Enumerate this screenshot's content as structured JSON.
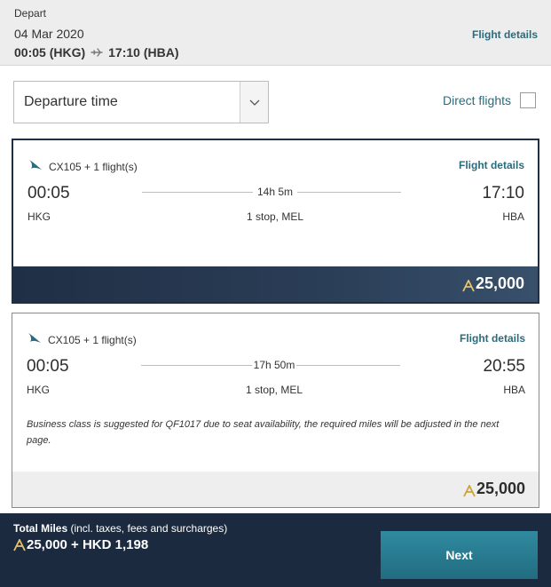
{
  "header": {
    "label": "Depart",
    "date": "04 Mar 2020",
    "departure": "00:05 (HKG)",
    "arrival": "17:10 (HBA)",
    "flight_details": "Flight details"
  },
  "filters": {
    "sort_value": "Departure time",
    "direct_label": "Direct flights",
    "direct_checked": false
  },
  "options": [
    {
      "flight": "CX105 + 1 flight(s)",
      "flight_details": "Flight details",
      "dep_time": "00:05",
      "arr_time": "17:10",
      "duration": "14h 5m",
      "dep_airport": "HKG",
      "arr_airport": "HBA",
      "stops": "1 stop, MEL",
      "note": "",
      "price": "25,000",
      "selected": true
    },
    {
      "flight": "CX105 + 1 flight(s)",
      "flight_details": "Flight details",
      "dep_time": "00:05",
      "arr_time": "20:55",
      "duration": "17h 50m",
      "dep_airport": "HKG",
      "arr_airport": "HBA",
      "stops": "1 stop, MEL",
      "note": "Business class is suggested for QF1017 due to seat availability, the required miles will be adjusted in the next page.",
      "price": "25,000",
      "selected": false
    }
  ],
  "footer": {
    "label_bold": "Total Miles",
    "label_rest": " (incl. taxes, fees and surcharges)",
    "total": "25,000 + HKD 1,198",
    "next_label": "Next"
  },
  "colors": {
    "accent": "#2a6b7c",
    "dark_navy": "#1f2f45",
    "footer_bg": "#1c2a3f",
    "next_button": "#2f8aa0"
  },
  "icons": {
    "airline_logo": "brushwing-logo-icon",
    "plane": "plane-icon",
    "miles": "asia-miles-icon",
    "dropdown": "chevron-down-icon"
  }
}
